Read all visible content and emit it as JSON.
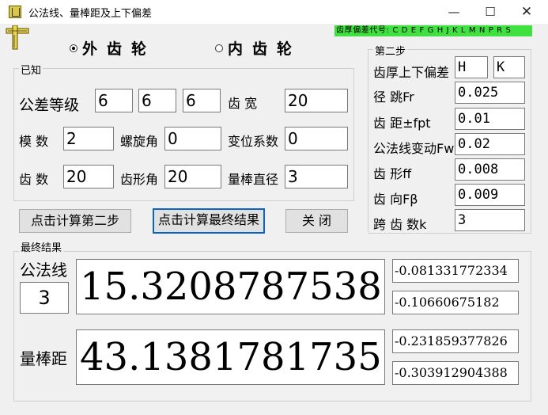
{
  "window": {
    "title": "公法线、量棒距及上下偏差",
    "min_glyph": "—",
    "max_glyph": "☐",
    "close_glyph": "✕"
  },
  "banner": "齿厚偏差代号: C D E F G H J K L M N P R S",
  "gear_type": {
    "external_label": "外齿轮",
    "internal_label": "内齿轮",
    "selected": "external"
  },
  "known": {
    "title": "已知",
    "tolerance_label": "公差等级",
    "tolerance_values": [
      "6",
      "6",
      "6"
    ],
    "face_width_label": "齿  宽",
    "face_width": "20",
    "module_label": "模  数",
    "module": "2",
    "helix_label": "螺旋角",
    "helix": "0",
    "shift_label": "变位系数",
    "shift": "0",
    "teeth_label": "齿  数",
    "teeth": "20",
    "pressure_label": "齿形角",
    "pressure": "20",
    "pin_label": "量棒直径",
    "pin": "3"
  },
  "step2": {
    "title": "第二步",
    "thickness_label": "齿厚上下偏差",
    "upper_code": "H",
    "lower_code": "K",
    "fr_label": "径   跳Fr",
    "fr": "0.025",
    "fpt_label": "齿  距±fpt",
    "fpt": "0.01",
    "fw_label": "公法线变动Fw",
    "fw": "0.02",
    "ff_label": "齿   形ff",
    "ff": "0.008",
    "fb_label": "齿   向Fβ",
    "fb": "0.009",
    "k_label": "跨 齿 数k",
    "k": "3"
  },
  "buttons": {
    "step2": "点击计算第二步",
    "final": "点击计算最终结果",
    "close": "关  闭"
  },
  "results": {
    "title": "最终结果",
    "w_label": "公法线",
    "w_k": "3",
    "w_value": "15.32087875386",
    "w_upper": "-0.081331772334",
    "w_lower": "-0.10660675182",
    "m_label": "量棒距",
    "m_value": "43.13817817353",
    "m_upper": "-0.231859377826",
    "m_lower": "-0.303912904388"
  }
}
